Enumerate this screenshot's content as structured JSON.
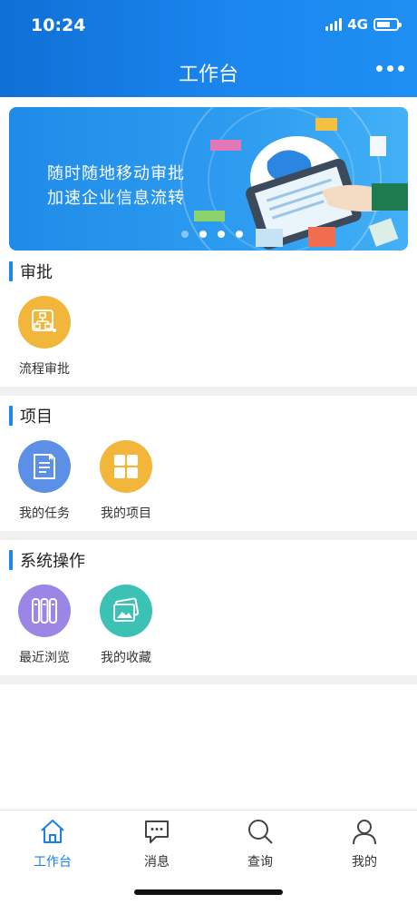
{
  "status_bar": {
    "time": "10:24",
    "network": "4G"
  },
  "header": {
    "title": "工作台"
  },
  "banner": {
    "line1": "随时随地移动审批",
    "line2": "加速企业信息流转"
  },
  "sections": [
    {
      "title": "审批",
      "items": [
        {
          "label": "流程审批",
          "icon": "flowchart-icon",
          "color": "#f2b63a"
        }
      ]
    },
    {
      "title": "项目",
      "items": [
        {
          "label": "我的任务",
          "icon": "document-icon",
          "color": "#5c8fe6"
        },
        {
          "label": "我的项目",
          "icon": "grid-icon",
          "color": "#f2b63a"
        }
      ]
    },
    {
      "title": "系统操作",
      "items": [
        {
          "label": "最近浏览",
          "icon": "binders-icon",
          "color": "#9b86e6"
        },
        {
          "label": "我的收藏",
          "icon": "picture-icon",
          "color": "#3cc2b4"
        }
      ]
    }
  ],
  "tabbar": [
    {
      "label": "工作台",
      "icon": "home-icon",
      "active": true
    },
    {
      "label": "消息",
      "icon": "message-icon",
      "active": false
    },
    {
      "label": "查询",
      "icon": "search-icon",
      "active": false
    },
    {
      "label": "我的",
      "icon": "user-icon",
      "active": false
    }
  ],
  "colors": {
    "brand": "#1a86ee",
    "tab_active": "#1a7fe8",
    "divider": "#f0f0f0"
  }
}
